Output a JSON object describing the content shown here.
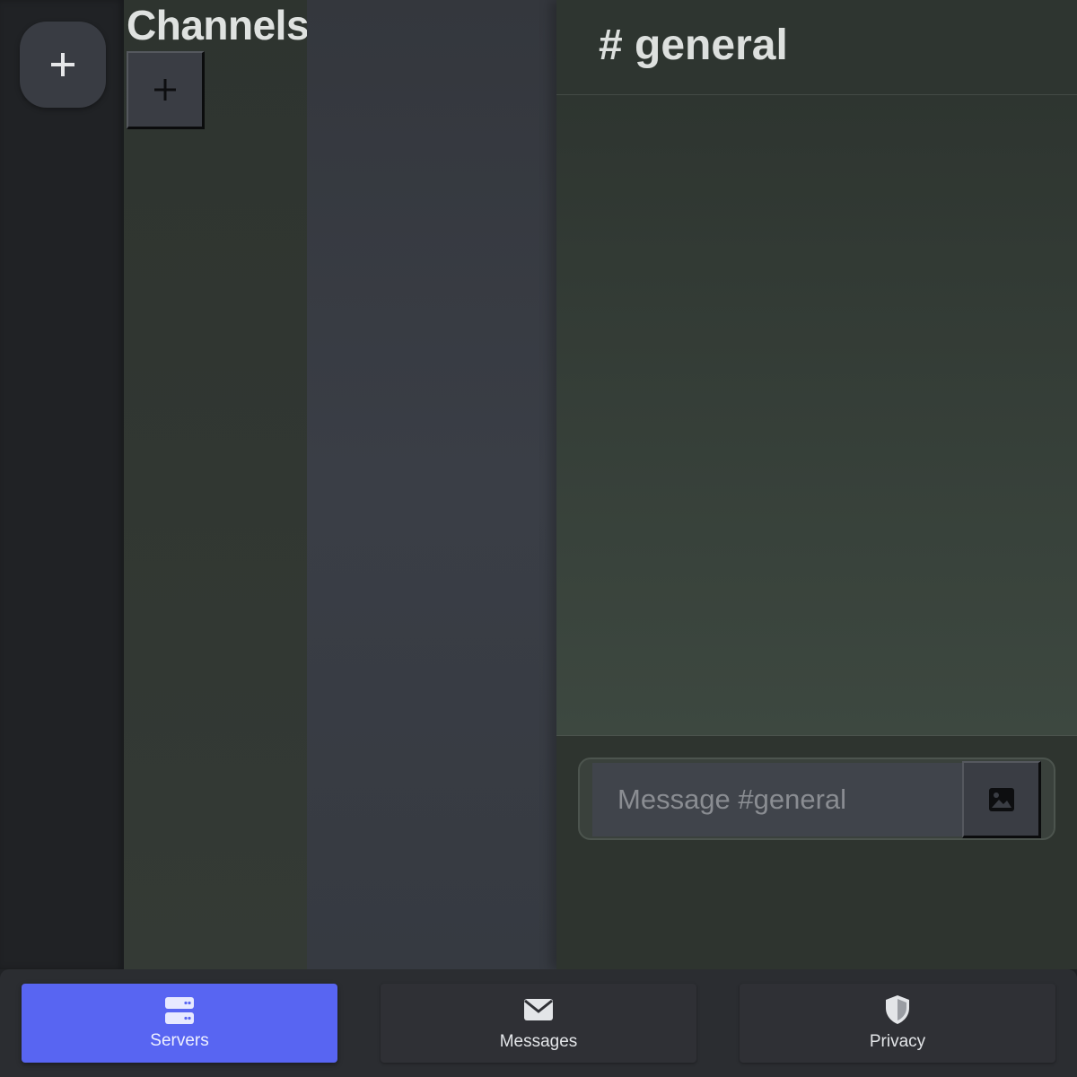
{
  "server_rail": {
    "add_server_icon": "plus-icon"
  },
  "channels": {
    "title": "Channels",
    "add_channel_icon": "plus-icon"
  },
  "chat": {
    "title": "# general",
    "composer": {
      "placeholder": "Message #general",
      "value": "",
      "image_button_icon": "image-icon"
    }
  },
  "bottom_nav": {
    "active": "Servers",
    "items": [
      {
        "label": "Servers",
        "icon": "server-icon"
      },
      {
        "label": "Messages",
        "icon": "envelope-icon"
      },
      {
        "label": "Privacy",
        "icon": "shield-icon"
      }
    ]
  },
  "colors": {
    "accent": "#5865f2",
    "rail": "#202225",
    "channels_bg": "#2e342f",
    "chat_bg": "#2e3530"
  }
}
